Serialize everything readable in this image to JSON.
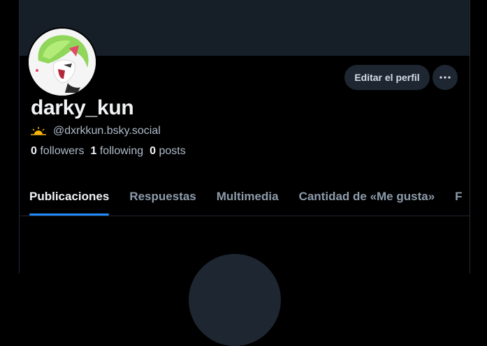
{
  "profile": {
    "display_name": "darky_kun",
    "handle": "@dxrkkun.bsky.social",
    "status_emoji": "sun-icon"
  },
  "actions": {
    "edit_label": "Editar el perfil",
    "more_label": "more-options-icon"
  },
  "stats": {
    "followers_count": "0",
    "followers_label": "followers",
    "following_count": "1",
    "following_label": "following",
    "posts_count": "0",
    "posts_label": "posts"
  },
  "tabs": [
    {
      "label": "Publicaciones"
    },
    {
      "label": "Respuestas"
    },
    {
      "label": "Multimedia"
    },
    {
      "label": "Cantidad de «Me gusta»"
    },
    {
      "label": "F"
    }
  ],
  "colors": {
    "background": "#000000",
    "banner": "#161e27",
    "accent": "#208bfe",
    "muted_text": "#aebbc9",
    "button_bg": "#1e2731"
  }
}
